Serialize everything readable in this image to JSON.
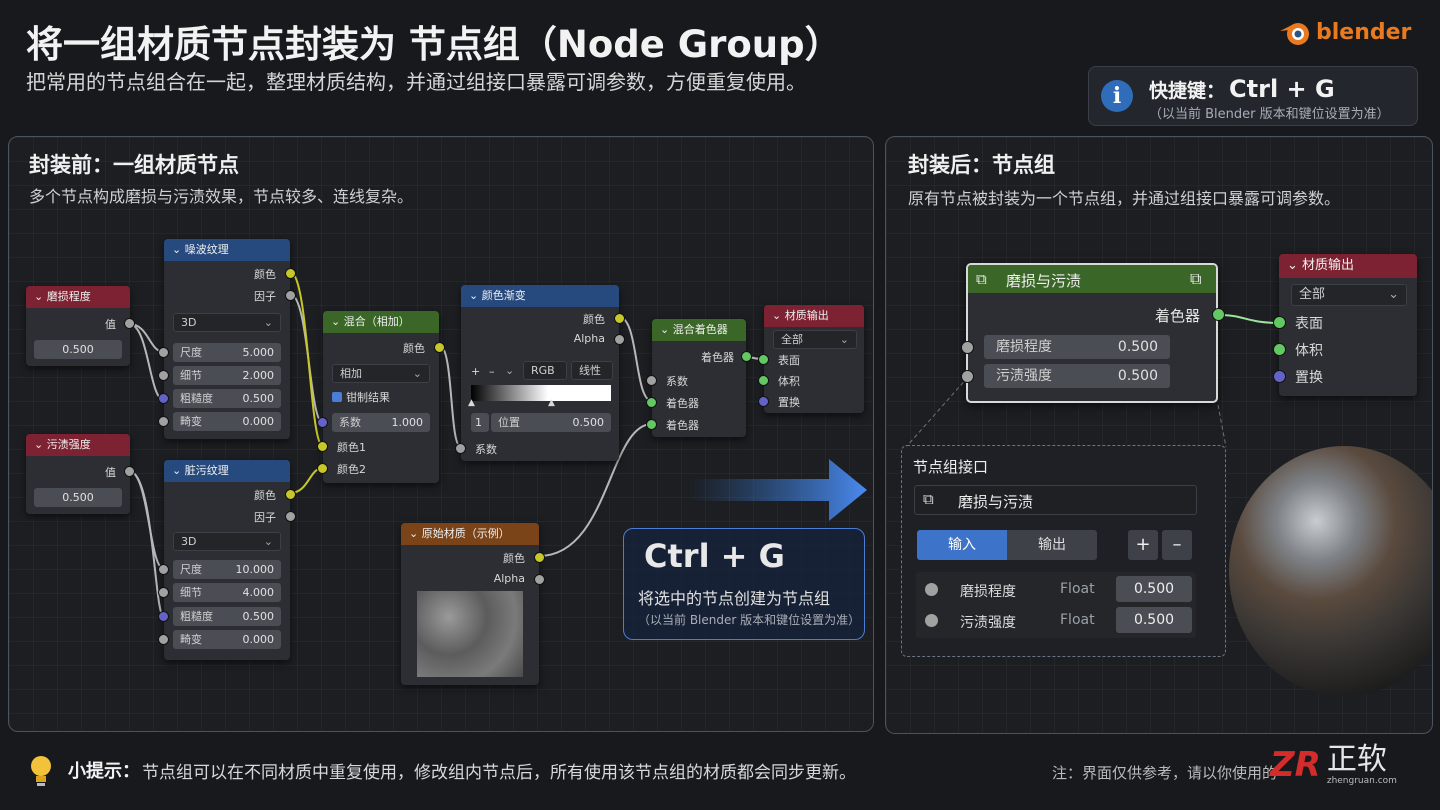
{
  "header": {
    "title": "将一组材质节点封装为 节点组（Node Group）",
    "subtitle": "把常用的节点组合在一起，整理材质结构，并通过组接口暴露可调参数，方便重复使用。",
    "logo_text": "blender"
  },
  "shortcut": {
    "label": "快捷键：",
    "keys": "Ctrl + G",
    "note": "（以当前 Blender 版本和键位设置为准）"
  },
  "before": {
    "title": "封装前：一组材质节点",
    "desc": "多个节点构成磨损与污渍效果，节点较多、连线复杂。",
    "wear_node": {
      "title": "磨损程度",
      "out": "值",
      "value": "0.500"
    },
    "dirt_node": {
      "title": "污渍强度",
      "out": "值",
      "value": "0.500"
    },
    "noise_node": {
      "title": "噪波纹理",
      "out_color": "颜色",
      "out_factor": "因子",
      "dim": "3D",
      "rows": [
        {
          "label": "尺度",
          "value": "5.000"
        },
        {
          "label": "细节",
          "value": "2.000"
        },
        {
          "label": "粗糙度",
          "value": "0.500"
        },
        {
          "label": "畸变",
          "value": "0.000"
        }
      ]
    },
    "dirt_tex_node": {
      "title": "脏污纹理",
      "out_color": "颜色",
      "out_factor": "因子",
      "dim": "3D",
      "rows": [
        {
          "label": "尺度",
          "value": "10.000"
        },
        {
          "label": "细节",
          "value": "4.000"
        },
        {
          "label": "粗糙度",
          "value": "0.500"
        },
        {
          "label": "畸变",
          "value": "0.000"
        }
      ]
    },
    "mix_node": {
      "title": "混合（相加）",
      "out": "颜色",
      "mode": "相加",
      "clamp": "钳制结果",
      "factor_label": "系数",
      "factor_value": "1.000",
      "in1": "颜色1",
      "in2": "颜色2"
    },
    "ramp_node": {
      "title": "颜色渐变",
      "out_color": "颜色",
      "out_alpha": "Alpha",
      "plus": "+",
      "minus": "–",
      "mode": "RGB",
      "interp": "线性",
      "stop_index": "1",
      "pos_label": "位置",
      "pos_value": "0.500",
      "in": "系数"
    },
    "mix_shader_node": {
      "title": "混合着色器",
      "out": "着色器",
      "in_fac": "系数",
      "in_a": "着色器",
      "in_b": "着色器"
    },
    "output_node": {
      "title": "材质输出",
      "target": "全部",
      "in_surface": "表面",
      "in_volume": "体积",
      "in_disp": "置换"
    },
    "base_node": {
      "title": "原始材质（示例）",
      "out_color": "颜色",
      "out_alpha": "Alpha"
    }
  },
  "ctrl_g": {
    "keys": "Ctrl + G",
    "desc": "将选中的节点创建为节点组",
    "note": "（以当前 Blender 版本和键位设置为准）"
  },
  "after": {
    "title": "封装后：节点组",
    "desc": "原有节点被封装为一个节点组，并通过组接口暴露可调参数。",
    "group_node": {
      "title": "磨损与污渍",
      "out": "着色器",
      "inputs": [
        {
          "label": "磨损程度",
          "value": "0.500"
        },
        {
          "label": "污渍强度",
          "value": "0.500"
        }
      ]
    },
    "output_node": {
      "title": "材质输出",
      "target": "全部",
      "in_surface": "表面",
      "in_volume": "体积",
      "in_disp": "置换"
    },
    "interface": {
      "title": "节点组接口",
      "group_name": "磨损与污渍",
      "tab_input": "输入",
      "tab_output": "输出",
      "add": "+",
      "remove": "–",
      "items": [
        {
          "name": "磨损程度",
          "type": "Float",
          "value": "0.500"
        },
        {
          "name": "污渍强度",
          "type": "Float",
          "value": "0.500"
        }
      ]
    }
  },
  "footer": {
    "tip_label": "小提示：",
    "tip_text": "节点组可以在不同材质中重复使用，修改组内节点后，所有使用该节点组的材质都会同步更新。",
    "note": "注：界面仅供参考，请以你使用的",
    "watermark": "正软",
    "watermark_url": "zhengruan.com"
  },
  "colors": {
    "accent": "#2f6dbb",
    "float_socket": "#a1a1a1",
    "color_socket": "#c7c729",
    "shader_socket": "#63c763",
    "vector_socket": "#6363c7"
  }
}
